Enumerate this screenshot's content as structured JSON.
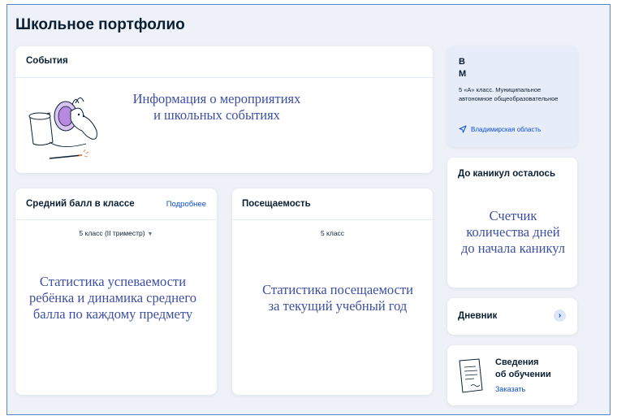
{
  "page": {
    "title": "Школьное портфолио"
  },
  "events": {
    "title": "События",
    "note_line1": "Информация о мероприятиях",
    "note_line2": "и школьных событиях"
  },
  "grade": {
    "title": "Средний балл в классе",
    "more_link": "Подробнее",
    "selector_value": "5 класс (II триместр)",
    "note_line1": "Статистика успеваемости",
    "note_line2": "ребёнка и динамика среднего",
    "note_line3": "балла по каждому предмету"
  },
  "attendance": {
    "title": "Посещаемость",
    "grade_label": "5 класс",
    "note_line1": "Статистика посещаемости",
    "note_line2": "за текущий учебный год"
  },
  "profile": {
    "initial1": "В",
    "initial2": "М",
    "school_line1": "5 «А» класс. Муниципальное",
    "school_line2": "автономное общеобразовательное",
    "region": "Владимирская область"
  },
  "holiday": {
    "title": "До каникул осталось",
    "note_line1": "Счетчик",
    "note_line2": "количества дней",
    "note_line3": "до  начала каникул"
  },
  "diary": {
    "title": "Дневник"
  },
  "education": {
    "title_line1": "Сведения",
    "title_line2": "об обучении",
    "link": "Заказать"
  },
  "colors": {
    "accent": "#0d4cd3",
    "annotation": "#3d4fa3",
    "profile_bg": "#e6edf8",
    "frame": "#5a86c9"
  },
  "icons": [
    "events-illustration",
    "caret-down-icon",
    "location-arrow-icon",
    "chevron-right-icon",
    "document-icon"
  ]
}
